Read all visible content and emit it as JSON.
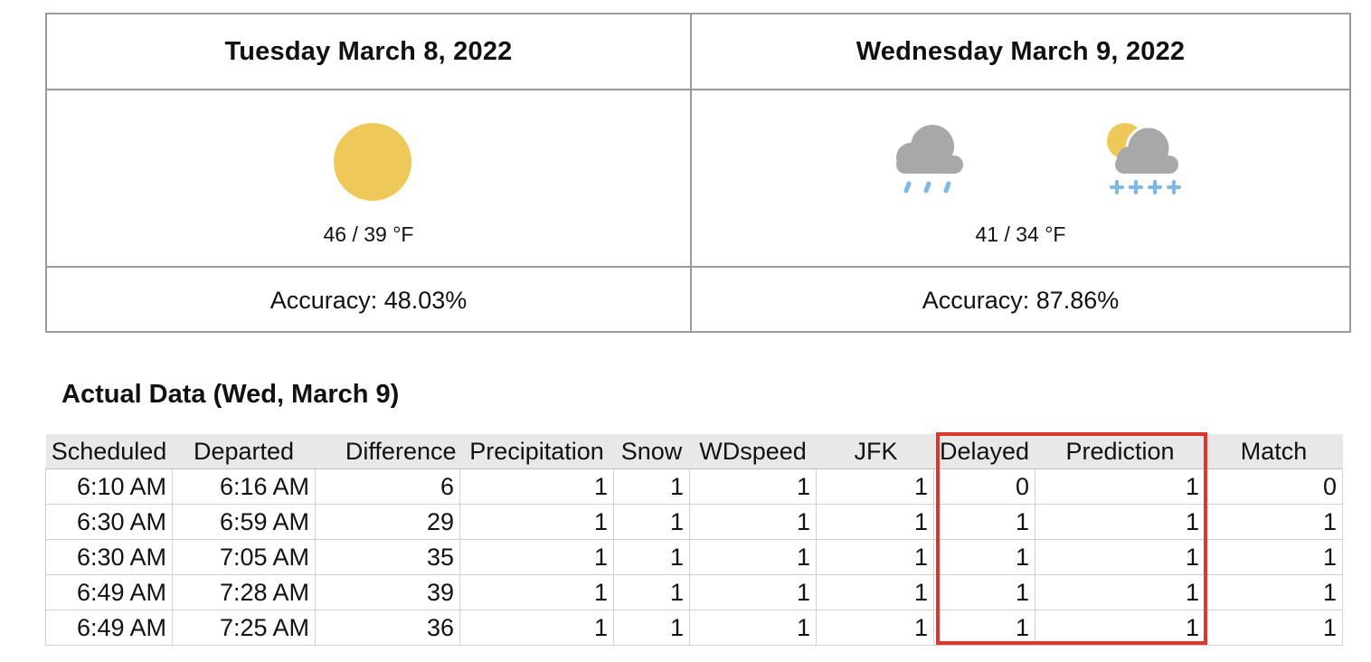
{
  "forecast": {
    "days": [
      {
        "date": "Tuesday March 8, 2022",
        "temp": "46 / 39 °F",
        "accuracy": "Accuracy: 48.03%",
        "icons": [
          "sun-icon"
        ]
      },
      {
        "date": "Wednesday March 9, 2022",
        "temp": "41 / 34 °F",
        "accuracy": "Accuracy: 87.86%",
        "icons": [
          "rain-cloud-icon",
          "snow-partly-cloudy-icon"
        ]
      }
    ]
  },
  "actual": {
    "title": "Actual Data (Wed, March 9)",
    "headers": [
      "Scheduled",
      "Departed",
      "Difference",
      "Precipitation",
      "Snow",
      "WDspeed",
      "JFK",
      "Delayed",
      "Prediction",
      "Match"
    ],
    "rows": [
      [
        "6:10 AM",
        "6:16 AM",
        "6",
        "1",
        "1",
        "1",
        "1",
        "0",
        "1",
        "0"
      ],
      [
        "6:30 AM",
        "6:59 AM",
        "29",
        "1",
        "1",
        "1",
        "1",
        "1",
        "1",
        "1"
      ],
      [
        "6:30 AM",
        "7:05 AM",
        "35",
        "1",
        "1",
        "1",
        "1",
        "1",
        "1",
        "1"
      ],
      [
        "6:49 AM",
        "7:28 AM",
        "39",
        "1",
        "1",
        "1",
        "1",
        "1",
        "1",
        "1"
      ],
      [
        "6:49 AM",
        "7:25 AM",
        "36",
        "1",
        "1",
        "1",
        "1",
        "1",
        "1",
        "1"
      ]
    ]
  },
  "colors": {
    "sun": "#efc85a",
    "cloud": "#a8a8a8",
    "rain": "#7db8e8",
    "highlight": "#e0352b"
  }
}
